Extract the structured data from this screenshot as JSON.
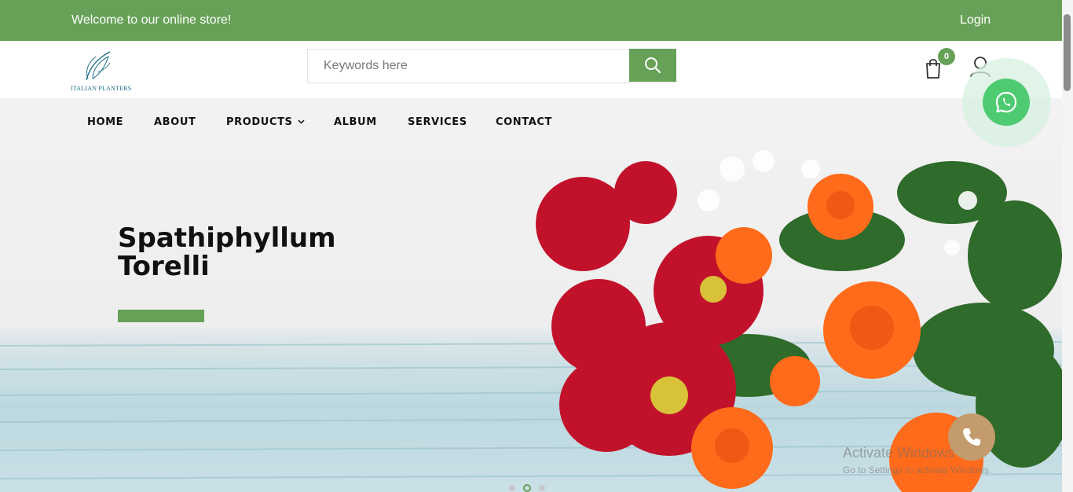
{
  "topbar": {
    "welcome": "Welcome to our online store!",
    "login": "Login"
  },
  "brand": {
    "logo_text": "ITALIAN PLANTERS",
    "logo_icon": "leaf-logo-icon"
  },
  "search": {
    "placeholder": "Keywords here",
    "value": "",
    "icon": "search-icon"
  },
  "cart": {
    "count": "0",
    "icon": "shopping-bag-icon"
  },
  "user": {
    "icon": "user-icon"
  },
  "nav": {
    "items": [
      "HOME",
      "ABOUT",
      "PRODUCTS",
      "ALBUM",
      "SERVICES",
      "CONTACT"
    ],
    "dropdown_icon": "chevron-down-icon"
  },
  "hero": {
    "title_line1": "Spathiphyllum",
    "title_line2": "Torelli",
    "slides": 3,
    "active_slide": 2
  },
  "floating": {
    "whatsapp_icon": "whatsapp-icon",
    "phone_icon": "phone-icon"
  },
  "watermark": {
    "line1": "Activate Windows",
    "line2": "Go to Settings to activate Windows."
  },
  "colors": {
    "accent": "#67a158",
    "whatsapp": "#4ecb71",
    "phone": "#c49b6c",
    "text": "#111111"
  }
}
